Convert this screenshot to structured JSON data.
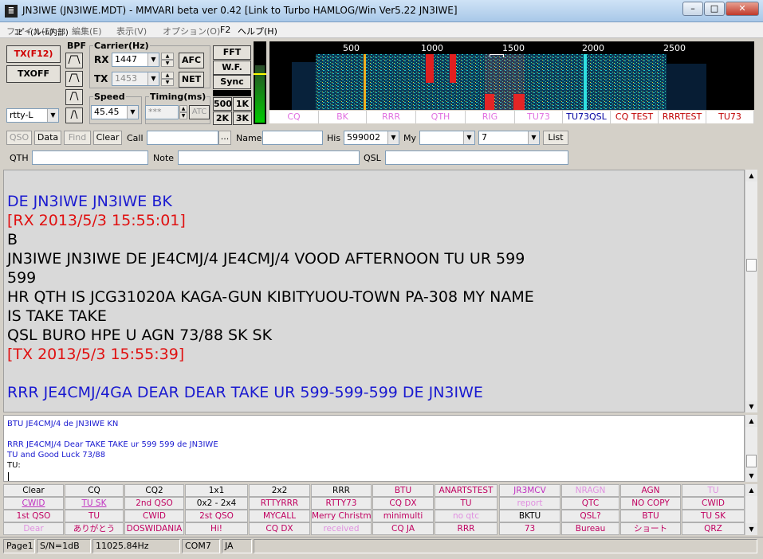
{
  "window": {
    "title": "JN3IWE (JN3IWE.MDT) - MMVARI beta ver 0.42 [Link to Turbo HAMLOG/Win Ver5.22 JN3IWE]",
    "icon_glyph": "≣"
  },
  "menu": {
    "file": "ファイル(F)",
    "edit": "編集(E)",
    "view": "表示(V)",
    "options": "オプション(O)",
    "help": "ヘルプ(H)",
    "overlay_text": "ｺﾋﾟｰ(ﾌﾚｰﾑ内部)",
    "f2_hint": "F2"
  },
  "controls": {
    "tx_button": "TX(F12)",
    "txoff_button": "TXOFF",
    "bpf_title": "BPF",
    "mode_select": "rtty-L",
    "carrier_title": "Carrier(Hz)",
    "rx_label": "RX",
    "rx_value": "1447",
    "tx_label": "TX",
    "tx_value": "1453",
    "afc": "AFC",
    "net": "NET",
    "speed_title": "Speed",
    "speed_value": "45.45",
    "timing_title": "Timing(ms)",
    "timing_value": "***",
    "atc": "ATC",
    "fft": "FFT",
    "wf": "W.F.",
    "sync": "Sync",
    "span_500": "500",
    "span_1k": "1K",
    "span_2k": "2K",
    "span_3k": "3K"
  },
  "spectrum": {
    "freq_ticks": [
      "500",
      "1000",
      "1500",
      "2000",
      "2500"
    ]
  },
  "macros_top": [
    {
      "label": "CQ",
      "color": "#e070e0"
    },
    {
      "label": "BK",
      "color": "#e070e0"
    },
    {
      "label": "RRR",
      "color": "#e070e0"
    },
    {
      "label": "QTH",
      "color": "#e070e0"
    },
    {
      "label": "RIG",
      "color": "#e070e0"
    },
    {
      "label": "TU73",
      "color": "#e070e0"
    },
    {
      "label": "TU73QSL",
      "color": "#0000a0"
    },
    {
      "label": "CQ TEST",
      "color": "#c00000"
    },
    {
      "label": "RRRTEST",
      "color": "#c00000"
    },
    {
      "label": "TU73",
      "color": "#c00000"
    }
  ],
  "qso": {
    "qso_btn": "QSO",
    "data_btn": "Data",
    "find_btn": "Find",
    "clear_btn": "Clear",
    "call_label": "Call",
    "call_value": "",
    "ellipsis": "...",
    "name_label": "Name",
    "name_value": "",
    "his_label": "His",
    "his_value": "599002",
    "my_label": "My",
    "my_value": "",
    "band_value": "7",
    "list_btn": "List",
    "qth_label": "QTH",
    "qth_value": "",
    "note_label": "Note",
    "note_value": "",
    "qsl_label": "QSL",
    "qsl_value": ""
  },
  "rx_text": [
    {
      "text": "DE JN3IWE JN3IWE BK",
      "color": "#1a1ad0"
    },
    {
      "text": "[RX 2013/5/3 15:55:01]",
      "color": "#e01010"
    },
    {
      "text": "B",
      "color": "#000000"
    },
    {
      "text": "JN3IWE JN3IWE DE JE4CMJ/4 JE4CMJ/4 VOOD AFTERNOON TU UR 599",
      "color": "#000000"
    },
    {
      "text": "599",
      "color": "#000000"
    },
    {
      "text": "HR QTH  IS  JCG31020A  KAGA-GUN KIBITYUOU-TOWN PA-308 MY NAME",
      "color": "#000000"
    },
    {
      "text": "IS TAKE TAKE",
      "color": "#000000"
    },
    {
      "text": "QSL BURO HPE U AGN 73/88  SK SK",
      "color": "#000000"
    },
    {
      "text": "[TX 2013/5/3 15:55:39]",
      "color": "#e01010"
    },
    {
      "text": "",
      "color": "#000000"
    },
    {
      "text": "RRR JE4CMJ/4GA  DEAR DEAR TAKE  UR 599-599-599 DE JN3IWE",
      "color": "#1a1ad0"
    }
  ],
  "tx_text": [
    "BTU JE4CMJ/4 de JN3IWE KN",
    "",
    "RRR JE4CMJ/4 Dear TAKE TAKE ur 599 599 de JN3IWE",
    "TU and Good Luck 73/88",
    "TU:"
  ],
  "macro_grid": [
    [
      {
        "l": "Clear",
        "c": "#000"
      },
      {
        "l": "CQ",
        "c": "#000"
      },
      {
        "l": "CQ2",
        "c": "#000"
      },
      {
        "l": "1x1",
        "c": "#000"
      },
      {
        "l": "2x2",
        "c": "#000"
      },
      {
        "l": "RRR",
        "c": "#000"
      },
      {
        "l": "BTU",
        "c": "#c00060"
      },
      {
        "l": "ANARTSTEST",
        "c": "#c00060"
      },
      {
        "l": "JR3MCV",
        "c": "#c030c0"
      },
      {
        "l": "NRAGN",
        "c": "#e090e0"
      },
      {
        "l": "AGN",
        "c": "#c00060"
      },
      {
        "l": "TU",
        "c": "#e090e0"
      }
    ],
    [
      {
        "l": "CWID",
        "c": "#c030c0"
      },
      {
        "l": "TU SK",
        "c": "#c030c0"
      },
      {
        "l": "2nd QSO",
        "c": "#c00060"
      },
      {
        "l": "0x2 - 2x4",
        "c": "#000"
      },
      {
        "l": "RTTYRRR",
        "c": "#c00060"
      },
      {
        "l": "RTTY73",
        "c": "#c00060"
      },
      {
        "l": "CQ DX",
        "c": "#c00060"
      },
      {
        "l": "TU",
        "c": "#c00060"
      },
      {
        "l": "report",
        "c": "#e090e0"
      },
      {
        "l": "QTC",
        "c": "#c00060"
      },
      {
        "l": "NO COPY",
        "c": "#c00060"
      },
      {
        "l": "CWID",
        "c": "#c00060"
      }
    ],
    [
      {
        "l": "1st QSO",
        "c": "#c00060"
      },
      {
        "l": "TU",
        "c": "#c00060"
      },
      {
        "l": "CWID",
        "c": "#c00060"
      },
      {
        "l": "2st QSO",
        "c": "#c00060"
      },
      {
        "l": "MYCALL",
        "c": "#c00060"
      },
      {
        "l": "Merry Christma",
        "c": "#c00060"
      },
      {
        "l": "minimulti",
        "c": "#c00060"
      },
      {
        "l": "no qtc",
        "c": "#e090e0"
      },
      {
        "l": "BKTU",
        "c": "#000"
      },
      {
        "l": "QSL?",
        "c": "#c00060"
      },
      {
        "l": "BTU",
        "c": "#c00060"
      },
      {
        "l": "TU SK",
        "c": "#c00060"
      }
    ],
    [
      {
        "l": "Dear",
        "c": "#e090e0"
      },
      {
        "l": "ありがとう",
        "c": "#c00060"
      },
      {
        "l": "DOSWIDANIA",
        "c": "#c00060"
      },
      {
        "l": "Hi!",
        "c": "#c00060"
      },
      {
        "l": "CQ DX",
        "c": "#c00060"
      },
      {
        "l": "received",
        "c": "#e090e0"
      },
      {
        "l": "CQ JA",
        "c": "#c00060"
      },
      {
        "l": "RRR",
        "c": "#c00060"
      },
      {
        "l": "73",
        "c": "#c00060"
      },
      {
        "l": "Bureau",
        "c": "#c00060"
      },
      {
        "l": "ショート",
        "c": "#c00060"
      },
      {
        "l": "QRZ",
        "c": "#c00060"
      }
    ]
  ],
  "status": {
    "page": "Page1",
    "snr": "S/N=1dB",
    "sample": "11025.84Hz",
    "port": "COM7",
    "lang": "JA"
  },
  "colors": {
    "accent_red": "#e01010",
    "accent_blue": "#1a1ad0"
  }
}
